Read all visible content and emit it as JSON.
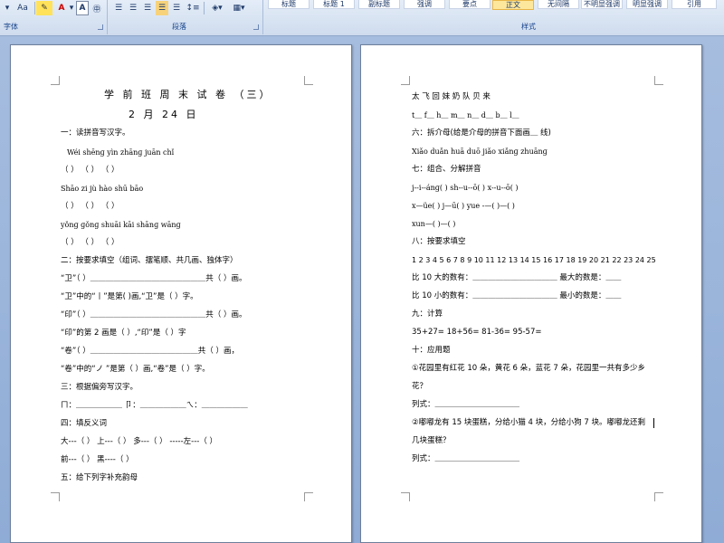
{
  "ribbon": {
    "font_size_btn": "Aa",
    "font_color_btn": "A",
    "groups": {
      "font": "字体",
      "paragraph": "段落",
      "styles": "样式"
    },
    "styles": [
      "标题",
      "标题 1",
      "副标题",
      "强调",
      "要点",
      "正文",
      "无间隔",
      "不明显强调",
      "明显强调",
      "引用"
    ],
    "active_style": "正文"
  },
  "left_page": {
    "title": "学 前 班 周 末 试 卷 （三）",
    "date": "2 月 24 日",
    "lines": [
      "一：读拼音写汉字。",
      "Wéi  shēnɡ        yìn  zhānɡ        juān     chǐ",
      "（              ）  （              ）  （              ）",
      "Shāo          zi          jù          hào          shū          bāo",
      "（              ）  （              ）  （              ）",
      "yǒnɡ   ɡǒnɡ        shuāi  kāi         shānɡ  wānɡ",
      "（              ）  （              ）  （              ）",
      "二：按要求填空（组词、摆笔顺、共几画、独体字）",
      "“卫”（        ）＿＿＿＿＿＿＿＿＿＿＿＿＿＿＿共（      ）画。",
      "“卫”中的“丨”是第(         )画,“卫”是（      ）字。",
      "“印”（        ）＿＿＿＿＿＿＿＿＿＿＿＿＿＿＿共（      ）画。",
      "“印”的第 2 画是（      ）,“印”是（      ）字",
      "“卷”（        ）＿＿＿＿＿＿＿＿＿＿＿＿＿＿共（        ）画，",
      "  “卷”中的“ノ ”是第（      ）画,“卷”是（        ）字。",
      "三：根据偏旁写汉字。",
      "ㄇ：＿＿＿＿＿＿ 卩：＿＿＿＿＿＿ㄟ：＿＿＿＿＿＿",
      "四：填反义词",
      "大---（      ）      上---（        ）          多---（      ）     -----左---（      ）",
      "前---（        ）           黑----（      ）",
      "五：给下列字补充韵母"
    ]
  },
  "right_page": {
    "lines": [
      "太          飞          回          妹          奶          队          贝          来",
      "t＿       f＿       h＿       m＿        n＿       d＿         b＿       l＿",
      "  六：拆介母(给是介母的拼音下面画＿  线)",
      "Xiǎo            duǎn   huā     duō   jiǎo    xiǎnɡ     zhuānɡ",
      "七：组合、分解拼音",
      "j--i--ánɡ(          )      sh--u--ō(     )    x--u--ō(        )",
      "x—üe(    )           j—ū(     )        yue -—(    )—(     )",
      "xun—(     )—(      )",
      "八：按要求填空",
      "1 2 3 4 5 6 7 8 9 10 11 12 13 14 15 16 17 18 19 20 21 22 23 24 25",
      "比 10 大的数有：＿＿＿＿＿＿＿＿＿＿＿  最大的数是：＿＿",
      "比 10 小的数有：＿＿＿＿＿＿＿＿＿＿＿  最小的数是：＿＿",
      "九：计算",
      "  35+27=        18+56=            81-36=            95-57=",
      "十：应用题",
      "①花园里有红花 10 朵，黄花 6 朵，蓝花 7 朵，花园里一共有多少乡",
      "花？",
      "      列式：＿＿＿＿＿＿＿＿＿＿＿",
      "②嘟嘟龙有 15 块蛋糕，分给小猫 4 块，分给小狗 7 块。嘟嘟龙还剩",
      "几块蛋糕？",
      "      列式：＿＿＿＿＿＿＿＿＿＿＿"
    ]
  }
}
